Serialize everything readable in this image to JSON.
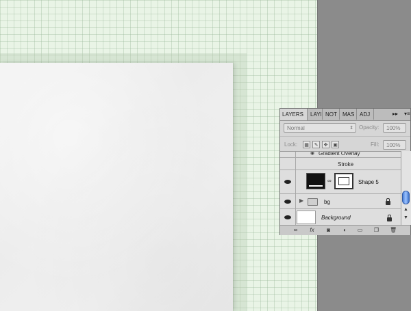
{
  "tabs": [
    {
      "label": "LAYERS"
    },
    {
      "label": "LAYI"
    },
    {
      "label": "NOT"
    },
    {
      "label": "MAS"
    },
    {
      "label": "ADJ"
    }
  ],
  "tab_menu": {
    "collapse_glyph": "▸▸",
    "menu_glyph": "▾≡"
  },
  "blend": {
    "mode": "Normal",
    "opacity_label": "Opacity:",
    "opacity_value": "100%"
  },
  "lock": {
    "label": "Lock:",
    "fill_label": "Fill:",
    "fill_value": "100%"
  },
  "layers": {
    "effect_partial": "Gradient Overlay",
    "stroke_label": "Stroke",
    "shape5": "Shape 5",
    "bg": "bg",
    "background": "Background"
  },
  "bottom_icons": [
    "link-icon",
    "fx-icon",
    "mask-icon",
    "adjustment-icon",
    "folder-icon",
    "new-layer-icon",
    "trash-icon"
  ]
}
